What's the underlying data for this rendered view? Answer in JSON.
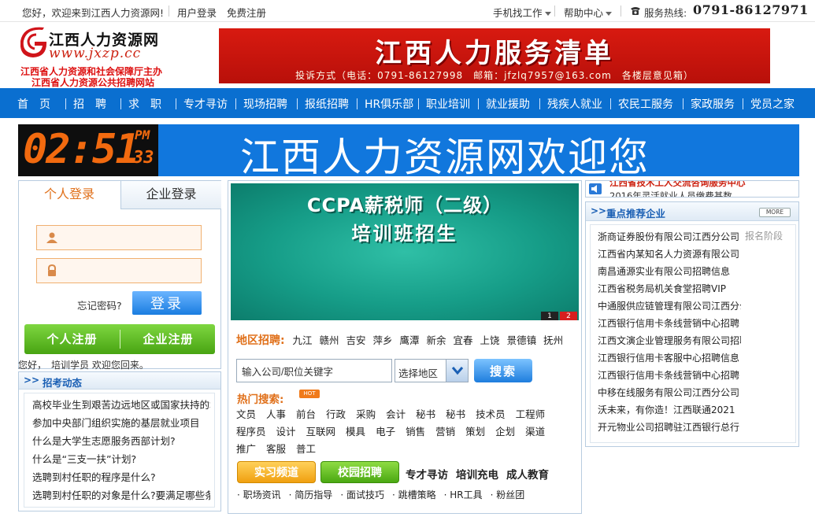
{
  "topbar": {
    "welcome": "您好，欢迎来到江西人力资源网!",
    "login": "用户登录",
    "register": "免费注册",
    "mobile": "手机找工作",
    "help": "帮助中心",
    "hotline_label": "服务热线:",
    "hotline": "0791-86127971"
  },
  "logo": {
    "name": "江西人力资源网",
    "url": "www.jxzp.cc",
    "sponsor1": "江西省人力资源和社会保障厅主办",
    "sponsor2": "江西省人力资源公共招聘网站"
  },
  "banner": {
    "title": "江西人力服务清单",
    "sub": "投诉方式（电话：0791-86127998　邮箱：jfzlq7957@163.com　各楼层意见箱）"
  },
  "nav": [
    "首　页",
    "招　聘",
    "求　职",
    "专才寻访",
    "现场招聘",
    "报纸招聘",
    "HR俱乐部",
    "职业培训",
    "就业援助",
    "残疾人就业",
    "农民工服务",
    "家政服务",
    "党员之家"
  ],
  "strip": {
    "clock_main": "02:5",
    "clock_min": "1",
    "clock_ampm": "PM",
    "clock_sec": "33",
    "message": "江西人力资源网欢迎您"
  },
  "login": {
    "tab_personal": "个人登录",
    "tab_company": "企业登录",
    "username": "",
    "password": "",
    "forgot": "忘记密码?",
    "login_btn": "登录",
    "reg_personal": "个人注册",
    "reg_company": "企业注册",
    "greeting": "您好，　培训学员 欢迎您回来。"
  },
  "news": {
    "title": "招考动态",
    "items": [
      "高校毕业生到艰苦边远地区或国家扶持的地区就业",
      "参加中央部门组织实施的基层就业项目",
      "什么是大学生志愿服务西部计划?",
      "什么是“三支一扶”计划?",
      "选聘到村任职的程序是什么?",
      "选聘到村任职的对象是什么?要满足哪些条件"
    ]
  },
  "slider": {
    "line1": "CCPA薪税师（二级）",
    "line2": "培训班招生",
    "pages": [
      "1",
      "2"
    ]
  },
  "region": {
    "label": "地区招聘:",
    "cities": [
      "九江",
      "赣州",
      "吉安",
      "萍乡",
      "鹰潭",
      "新余",
      "宜春",
      "上饶",
      "景德镇",
      "抚州"
    ]
  },
  "search": {
    "keyword": "输入公司/职位关键字",
    "area": "选择地区",
    "button": "搜索"
  },
  "hot": {
    "label": "热门搜索:",
    "badge": "HOT",
    "row1": [
      "文员",
      "人事",
      "前台",
      "行政",
      "采购",
      "会计",
      "秘书",
      "秘书",
      "技术员",
      "工程师"
    ],
    "row2": [
      "程序员",
      "设计",
      "互联网",
      "模具",
      "电子",
      "销售",
      "营销",
      "策划",
      "企划",
      "渠道"
    ],
    "row3": [
      "推广",
      "客服",
      "普工"
    ]
  },
  "channels": {
    "intern": "实习频道",
    "campus": "校园招聘",
    "links": [
      "专才寻访",
      "培训充电",
      "成人教育"
    ],
    "tips": [
      "职场资讯",
      "简历指导",
      "面试技巧",
      "跳槽策略",
      "HR工具",
      "粉丝团"
    ]
  },
  "notice": {
    "line1": "江西省技术工人交流咨询服务中心",
    "line2": "2016年灵活就业人员缴费基数…"
  },
  "recommend": {
    "title": "重点推荐企业",
    "more": "MORE",
    "tag": "报名阶段",
    "items": [
      "浙商证券股份有限公司江西分公司",
      "江西省内某知名人力资源有限公司",
      "南昌通源实业有限公司招聘信息",
      "江西省税务局机关食堂招聘VIP",
      "中通服供应链管理有限公司江西分公司",
      "江西银行信用卡条线营销中心招聘",
      "江西文演企业管理服务有限公司招聘",
      "江西银行信用卡客服中心招聘信息",
      "江西银行信用卡条线营销中心招聘",
      "中移在线服务有限公司江西分公司",
      "沃未来，有你造！江西联通2021",
      "开元物业公司招聘驻江西银行总行"
    ]
  },
  "colors": {
    "nav_blue": "#0a6fd0",
    "accent_orange": "#e0701a",
    "red": "#d81a10",
    "green": "#48a412"
  }
}
